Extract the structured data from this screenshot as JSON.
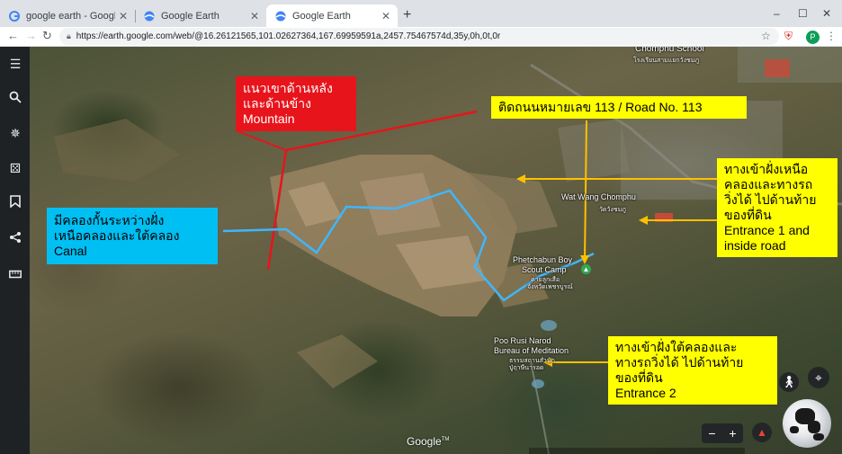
{
  "browser": {
    "tabs": [
      {
        "title": "google earth - Google Search",
        "favicon": "google-g-icon",
        "active": false
      },
      {
        "title": "Google Earth",
        "favicon": "google-earth-icon",
        "active": false
      },
      {
        "title": "Google Earth",
        "favicon": "google-earth-icon",
        "active": true
      }
    ],
    "new_tab": "+",
    "url": "https://earth.google.com/web/@16.26121565,101.02627364,167.69959591a,2457.75467574d,35y,0h,0t,0r",
    "profile_initial": "P",
    "window_controls": [
      "–",
      "☐",
      "✕"
    ]
  },
  "sidebar": {
    "items": [
      "menu-icon",
      "search-icon",
      "voyager-icon",
      "feeling-lucky-icon",
      "projects-icon",
      "share-icon",
      "measure-icon"
    ]
  },
  "annotations": {
    "mountain": {
      "lines": [
        "แนวเขาด้านหลัง",
        "และด้านข้าง",
        "Mountain"
      ],
      "color": "#e8141b"
    },
    "road": {
      "lines": [
        "ติดถนนหมายเลข 113 / Road No. 113"
      ],
      "color": "#ffff00"
    },
    "entrance1": {
      "lines": [
        "ทางเข้าฝั่งเหนือ",
        "คลองและทางรถ",
        "วิ่งได้ ไปด้านท้าย",
        "ของที่ดิน",
        "Entrance 1 and",
        "inside road"
      ],
      "color": "#ffff00"
    },
    "canal": {
      "lines": [
        "มีคลองกั้นระหว่างฝั่ง",
        "เหนือคลองและใต้คลอง",
        "Canal"
      ],
      "color": "#00bff3"
    },
    "entrance2": {
      "lines": [
        "ทางเข้าฝั่งใต้คลองและ",
        "ทางรถวิ่งได้ ไปด้านท้าย",
        "ของที่ดิน",
        "Entrance 2"
      ],
      "color": "#ffff00"
    }
  },
  "map_labels": {
    "chomphu_school": "Chomphu School",
    "chomphu_school_th": "โรงเรียนสามแยกวังชมภู",
    "wat_wang_chomphu": "Wat Wang Chomphu",
    "wat_wang_chomphu_th": "วัดวังชมภู",
    "scout_camp": "Phetchabun Boy Scout Camp",
    "scout_camp_l1": "Phetchabun Boy",
    "scout_camp_l2": "Scout Camp",
    "scout_camp_th1": "ค่ายลูกเสือ",
    "scout_camp_th2": "จังหวัดเพชรบูรณ์",
    "poo_rusi_l1": "Poo Rusi Narod",
    "poo_rusi_l2": "Bureau of Meditation",
    "poo_rusi_th1": "ธรรมสถานสำนัก",
    "poo_rusi_th2": "ปู่ฤาษีนารอด"
  },
  "controls": {
    "zoom_out": "−",
    "zoom_in": "+",
    "google_logo": "Google",
    "google_logo_tm": "TM"
  },
  "colors": {
    "mountain_line": "#e8141b",
    "road_arrow": "#ffc000",
    "canal_line": "#3fb6ff"
  }
}
